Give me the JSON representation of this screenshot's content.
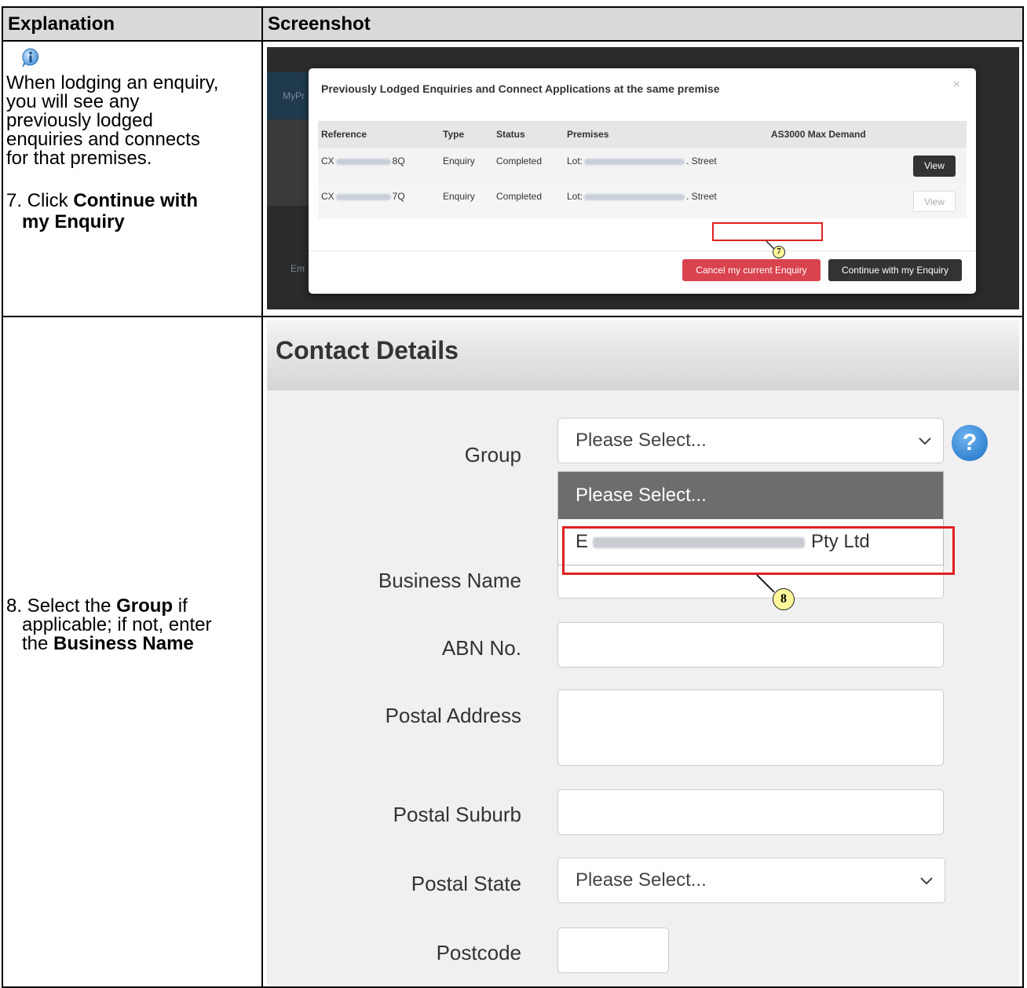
{
  "table": {
    "header_explanation": "Explanation",
    "header_screenshot": "Screenshot"
  },
  "row1": {
    "text_line1": "When lodging an enquiry,",
    "text_line2": "you will see any",
    "text_line3": "previously lodged",
    "text_line4": "enquiries and connects",
    "text_line5": "for that premises.",
    "step_prefix": "7. Click ",
    "step_bold_1": "Continue with",
    "step_bold_2": "my Enquiry"
  },
  "row2": {
    "step_prefix": "8. Select the ",
    "step_bold_group": "Group",
    "step_after_group": " if",
    "line2": "applicable; if not, enter",
    "line3_prefix": "the ",
    "line3_bold": "Business Name"
  },
  "modal": {
    "title": "Previously Lodged Enquiries and Connect Applications at the same premise",
    "close": "×",
    "bg_text_1": "MyPr",
    "bg_text_2": "Em",
    "columns": [
      "Reference",
      "Type",
      "Status",
      "Premises",
      "AS3000 Max Demand"
    ],
    "rows": [
      {
        "ref_prefix": "CX",
        "ref_suffix": "8Q",
        "type": "Enquiry",
        "status": "Completed",
        "premises_prefix": "Lot:",
        "premises_suffix": ". Street",
        "view": "View",
        "view_state": "active"
      },
      {
        "ref_prefix": "CX",
        "ref_suffix": "7Q",
        "type": "Enquiry",
        "status": "Completed",
        "premises_prefix": "Lot:",
        "premises_suffix": ". Street",
        "view": "View",
        "view_state": "disabled"
      }
    ],
    "cancel_button": "Cancel my current Enquiry",
    "continue_button": "Continue with my Enquiry",
    "callout_number": "7"
  },
  "form": {
    "title": "Contact Details",
    "group_label": "Group",
    "group_value": "Please Select...",
    "help": "?",
    "dropdown_selected": "Please Select...",
    "dropdown_option_prefix": "E",
    "dropdown_option_suffix": "Pty Ltd",
    "callout_number": "8",
    "business_name_label": "Business Name",
    "abn_label": "ABN No.",
    "postal_address_label": "Postal Address",
    "postal_suburb_label": "Postal Suburb",
    "postal_state_label": "Postal State",
    "postal_state_value": "Please Select...",
    "postcode_label": "Postcode"
  },
  "colors": {
    "header_bg": "#d9d9d9",
    "callout_red": "#e02020",
    "callout_fill": "#fff79a",
    "cancel_red": "#d9434e",
    "dark_button": "#333333"
  }
}
